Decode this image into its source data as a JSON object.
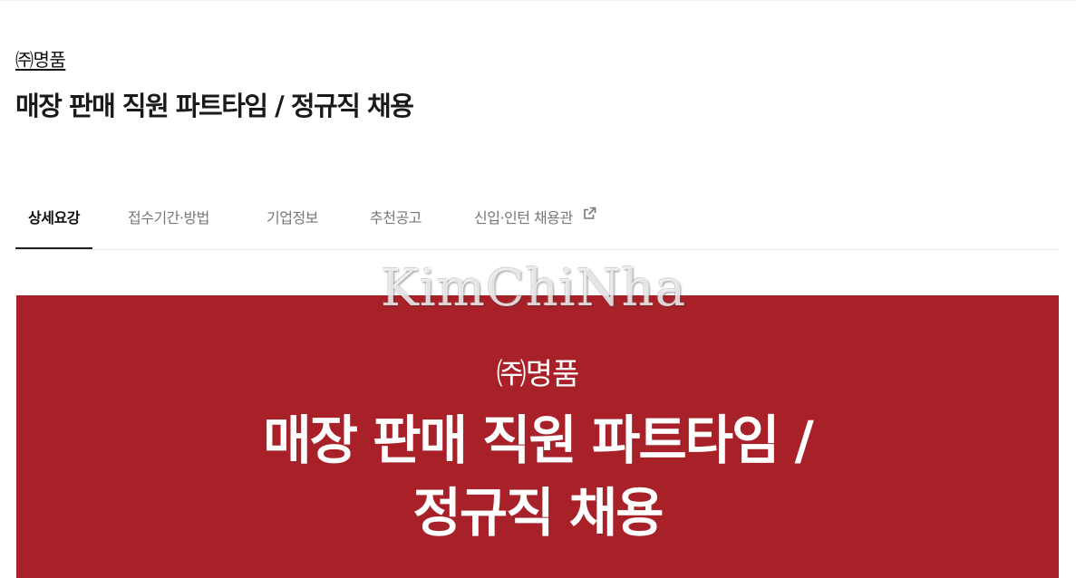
{
  "header": {
    "company_name": "㈜명품",
    "job_title": "매장 판매 직원 파트타임 / 정규직 채용"
  },
  "tabs": [
    {
      "label": "상세요강",
      "active": true
    },
    {
      "label": "접수기간·방법",
      "active": false
    },
    {
      "label": "기업정보",
      "active": false
    },
    {
      "label": "추천공고",
      "active": false
    },
    {
      "label": "신입·인턴 채용관",
      "active": false,
      "icon": "external-link-icon"
    }
  ],
  "banner": {
    "company": "㈜명품",
    "title_line1": "매장 판매 직원 파트타임 /",
    "title_line2": "정규직 채용",
    "background_color": "#a92128"
  },
  "watermark": {
    "text": "KimChiNha"
  }
}
